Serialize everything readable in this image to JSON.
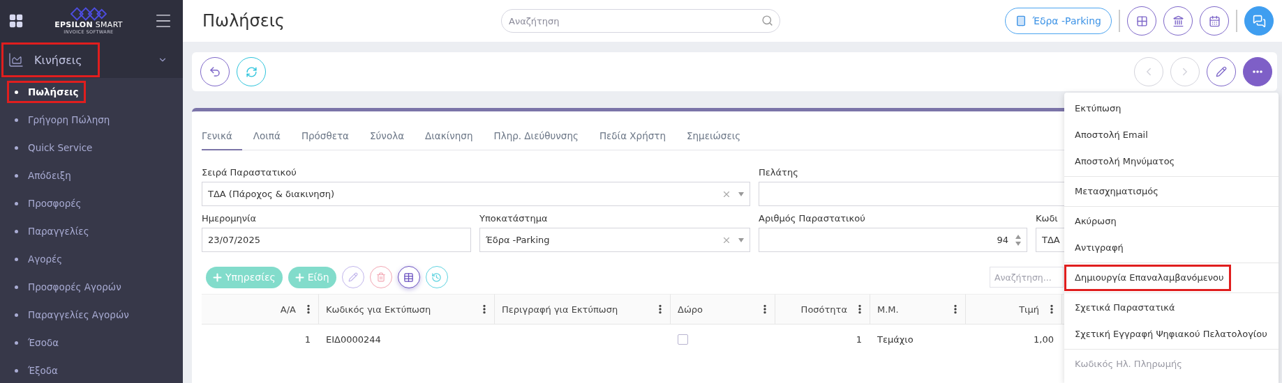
{
  "sidebar": {
    "logo": {
      "name": "**EPSILON** SMART",
      "tagline": "INVOICE SOFTWARE"
    },
    "section": {
      "label": "Κινήσεις",
      "expanded": true,
      "highlighted": true
    },
    "items": [
      {
        "label": "Πωλήσεις",
        "selected": true,
        "highlighted": true
      },
      {
        "label": "Γρήγορη Πώληση",
        "selected": false,
        "highlighted": false
      },
      {
        "label": "Quick Service",
        "selected": false,
        "highlighted": false
      },
      {
        "label": "Απόδειξη",
        "selected": false,
        "highlighted": false
      },
      {
        "label": "Προσφορές",
        "selected": false,
        "highlighted": false
      },
      {
        "label": "Παραγγελίες",
        "selected": false,
        "highlighted": false
      },
      {
        "label": "Αγορές",
        "selected": false,
        "highlighted": false
      },
      {
        "label": "Προσφορές Αγορών",
        "selected": false,
        "highlighted": false
      },
      {
        "label": "Παραγγελίες Αγορών",
        "selected": false,
        "highlighted": false
      },
      {
        "label": "Έσοδα",
        "selected": false,
        "highlighted": false
      },
      {
        "label": "Έξοδα",
        "selected": false,
        "highlighted": false
      }
    ]
  },
  "header": {
    "title": "Πωλήσεις",
    "search": {
      "placeholder": "Αναζήτηση"
    },
    "branch_button": "Έδρα -Parking"
  },
  "tabs": [
    {
      "label": "Γενικά",
      "selected": true
    },
    {
      "label": "Λοιπά",
      "selected": false
    },
    {
      "label": "Πρόσθετα",
      "selected": false
    },
    {
      "label": "Σύνολα",
      "selected": false
    },
    {
      "label": "Διακίνηση",
      "selected": false
    },
    {
      "label": "Πληρ. Διεύθυνσης",
      "selected": false
    },
    {
      "label": "Πεδία Χρήστη",
      "selected": false
    },
    {
      "label": "Σημειώσεις",
      "selected": false
    }
  ],
  "form": {
    "header_fields": [
      {
        "kind": "select",
        "label": "Σειρά Παραστατικού",
        "value": "ΤΔΑ (Πάροχος & διακινηση)"
      },
      {
        "kind": "text",
        "label": "Πελάτης"
      }
    ],
    "detail_fields": [
      {
        "kind": "text",
        "label": "Ημερομηνία",
        "value": "23/07/2025"
      },
      {
        "kind": "select",
        "label": "Υποκατάστημα",
        "value": "Έδρα -Parking"
      },
      {
        "kind": "number",
        "label": "Αριθμός Παραστατικού",
        "value": "94"
      },
      {
        "kind": "text",
        "label": "Κωδι",
        "value": "ΤΔΑ"
      }
    ]
  },
  "grid": {
    "buttons": [
      "Υπηρεσίες",
      "Είδη"
    ],
    "search": {
      "placeholder": "Αναζήτηση..."
    },
    "columns": [
      {
        "label": "Α/Α",
        "numeric": true
      },
      {
        "label": "Κωδικός για Εκτύπωση",
        "numeric": false
      },
      {
        "label": "Περιγραφή για Εκτύπωση",
        "numeric": false
      },
      {
        "label": "Δώρο",
        "numeric": false
      },
      {
        "label": "Ποσότητα",
        "numeric": true
      },
      {
        "label": "Μ.Μ.",
        "numeric": false
      },
      {
        "label": "Τιμή",
        "numeric": true
      }
    ],
    "rows": [
      {
        "aa": "1",
        "code": "ΕΙΔ0000244",
        "gift": false,
        "quantity": "1",
        "unit": "Τεμάχιο",
        "price": "1,00"
      }
    ]
  },
  "menu": {
    "groups": [
      {
        "items": [
          {
            "label": "Εκτύπωση",
            "disabled": false,
            "highlighted": false
          },
          {
            "label": "Αποστολή Email",
            "disabled": false,
            "highlighted": false
          },
          {
            "label": "Αποστολή Μηνύματος",
            "disabled": false,
            "highlighted": false
          }
        ]
      },
      {
        "items": [
          {
            "label": "Μετασχηματισμός",
            "disabled": false,
            "highlighted": false
          }
        ]
      },
      {
        "items": [
          {
            "label": "Ακύρωση",
            "disabled": false,
            "highlighted": false
          },
          {
            "label": "Αντιγραφή",
            "disabled": false,
            "highlighted": false
          }
        ]
      },
      {
        "items": [
          {
            "label": "Δημιουργία Επαναλαμβανόμενου",
            "disabled": false,
            "highlighted": true
          }
        ]
      },
      {
        "items": [
          {
            "label": "Σχετικά Παραστατικά",
            "disabled": false,
            "highlighted": false
          },
          {
            "label": "Σχετική Εγγραφή Ψηφιακού Πελατολογίου",
            "disabled": false,
            "highlighted": false
          }
        ]
      },
      {
        "items": [
          {
            "label": "Κωδικός Ηλ. Πληρωμής",
            "disabled": true,
            "highlighted": false
          }
        ]
      }
    ]
  }
}
